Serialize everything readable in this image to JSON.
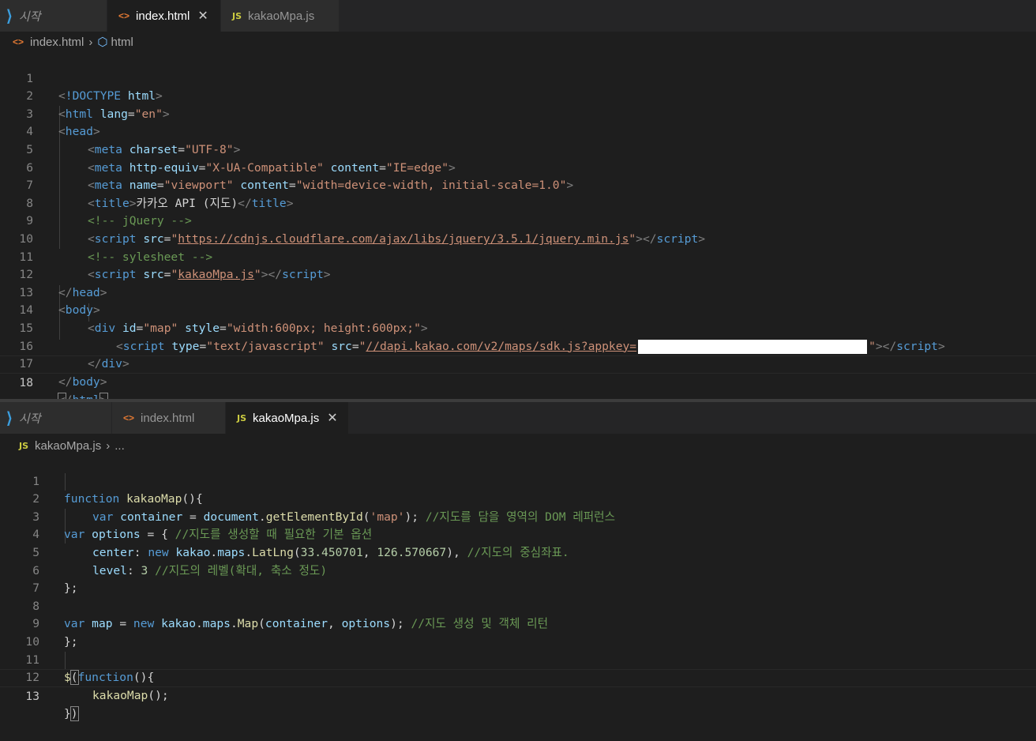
{
  "editor_top": {
    "tabs": [
      {
        "label": "시작",
        "icon": "vscode-logo-icon"
      },
      {
        "label": "index.html",
        "icon": "html-file-icon",
        "active": true
      },
      {
        "label": "kakaoMpa.js",
        "icon": "js-file-icon"
      }
    ],
    "breadcrumb": [
      "index.html",
      "html"
    ],
    "line_numbers": [
      "1",
      "2",
      "3",
      "4",
      "5",
      "6",
      "7",
      "8",
      "9",
      "10",
      "11",
      "12",
      "13",
      "14",
      "15",
      "16",
      "17",
      "18"
    ]
  },
  "editor_bottom": {
    "tabs": [
      {
        "label": "시작",
        "icon": "vscode-logo-icon"
      },
      {
        "label": "index.html",
        "icon": "html-file-icon"
      },
      {
        "label": "kakaoMpa.js",
        "icon": "js-file-icon",
        "active": true
      }
    ],
    "breadcrumb": [
      "kakaoMpa.js",
      "..."
    ],
    "line_numbers": [
      "1",
      "2",
      "3",
      "4",
      "5",
      "6",
      "7",
      "8",
      "9",
      "10",
      "11",
      "12",
      "13"
    ]
  },
  "html_code": {
    "doctype": "html",
    "lang": "en",
    "charset": "UTF-8",
    "http_equiv": "X-UA-Compatible",
    "content_ie": "IE=edge",
    "viewport_name": "viewport",
    "viewport_content": "width=device-width, initial-scale=1.0",
    "title": "카카오 API (지도)",
    "comment_jquery": "<!-- jQuery -->",
    "jquery_src": "https://cdnjs.cloudflare.com/ajax/libs/jquery/3.5.1/jquery.min.js",
    "comment_stylesheet": "<!-- sylesheet -->",
    "script_src": "kakaoMpa.js",
    "div_id": "map",
    "div_style": "width:600px; height:600px;",
    "script_type": "text/javascript",
    "kakao_src": "//dapi.kakao.com/v2/maps/sdk.js?appkey="
  },
  "js_code": {
    "fn_name": "kakaoMap",
    "container_id": "'map'",
    "comment_container": "//지도를 담을 영역의 DOM 레퍼런스",
    "comment_options": "//지도를 생성할 때 필요한 기본 옵션",
    "lat": "33.450701",
    "lng": "126.570667",
    "comment_center": "//지도의 중심좌표.",
    "level": "3",
    "comment_level": "//지도의 레벨(확대, 축소 정도)",
    "comment_map": "//지도 생성 및 객체 리턴"
  },
  "colors": {
    "background": "#1e1e1e",
    "tag": "#569cd6",
    "attribute": "#9cdcfe",
    "string": "#ce9178",
    "comment": "#6a9955"
  }
}
